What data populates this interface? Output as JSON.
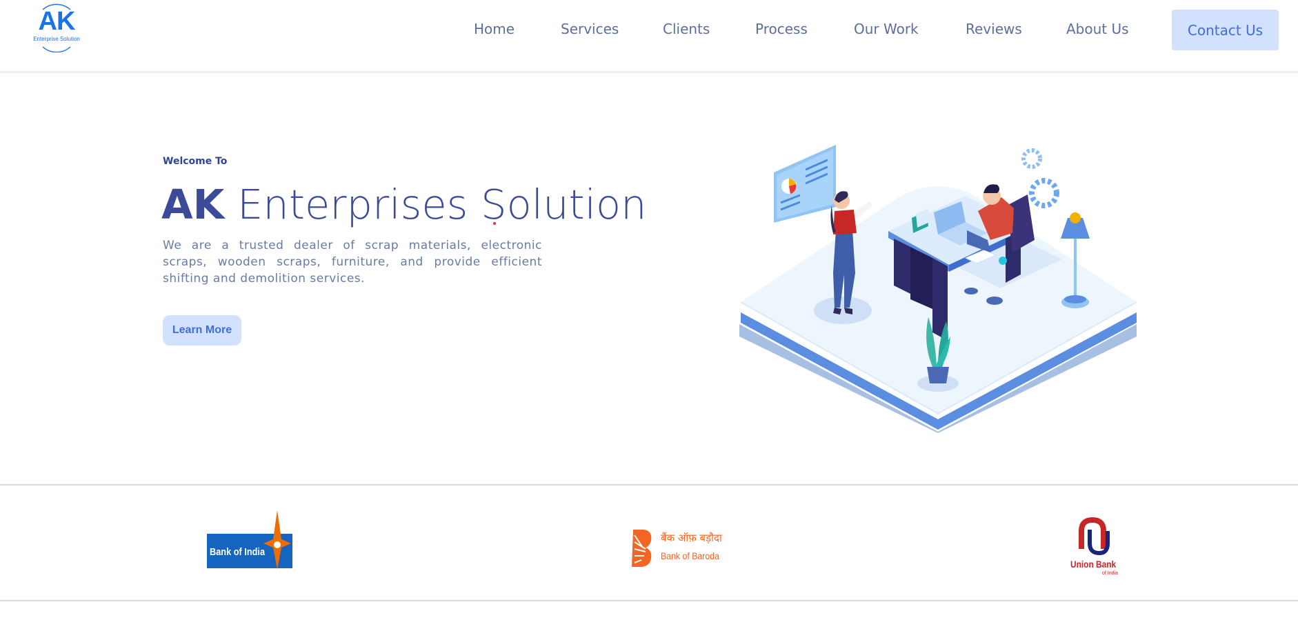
{
  "logo": {
    "mark": "AK",
    "subtitle": "Enterprise Solution"
  },
  "nav": {
    "items": [
      "Home",
      "Services",
      "Clients",
      "Process",
      "Our Work",
      "Reviews",
      "About Us"
    ],
    "contact_label": "Contact Us"
  },
  "hero": {
    "welcome": "Welcome To",
    "title_bold": "AK",
    "title_light": "Enterprises Solution",
    "description": "We are a trusted dealer of scrap materials, electronic scraps, wooden scraps, furniture, and provide efficient shifting and demolition services.",
    "cta_label": "Learn More",
    "illustration_icon": "office-desk-illustration"
  },
  "clients": [
    {
      "name": "Bank of India",
      "label": "Bank of India",
      "color": "#1565c0",
      "accent": "#ef6c00"
    },
    {
      "name": "Bank of Baroda",
      "label_hi": "बैंक ऑफ़ बड़ौदा",
      "label": "Bank of Baroda",
      "color": "#f26522"
    },
    {
      "name": "Union Bank of India",
      "label": "Union Bank",
      "sub": "of India",
      "color": "#c62828",
      "accent": "#1a237e"
    }
  ],
  "colors": {
    "primary": "#3b4b99",
    "accent": "#1a73e8",
    "button_bg": "#d2e1fe",
    "button_text": "#3f6ed8"
  }
}
